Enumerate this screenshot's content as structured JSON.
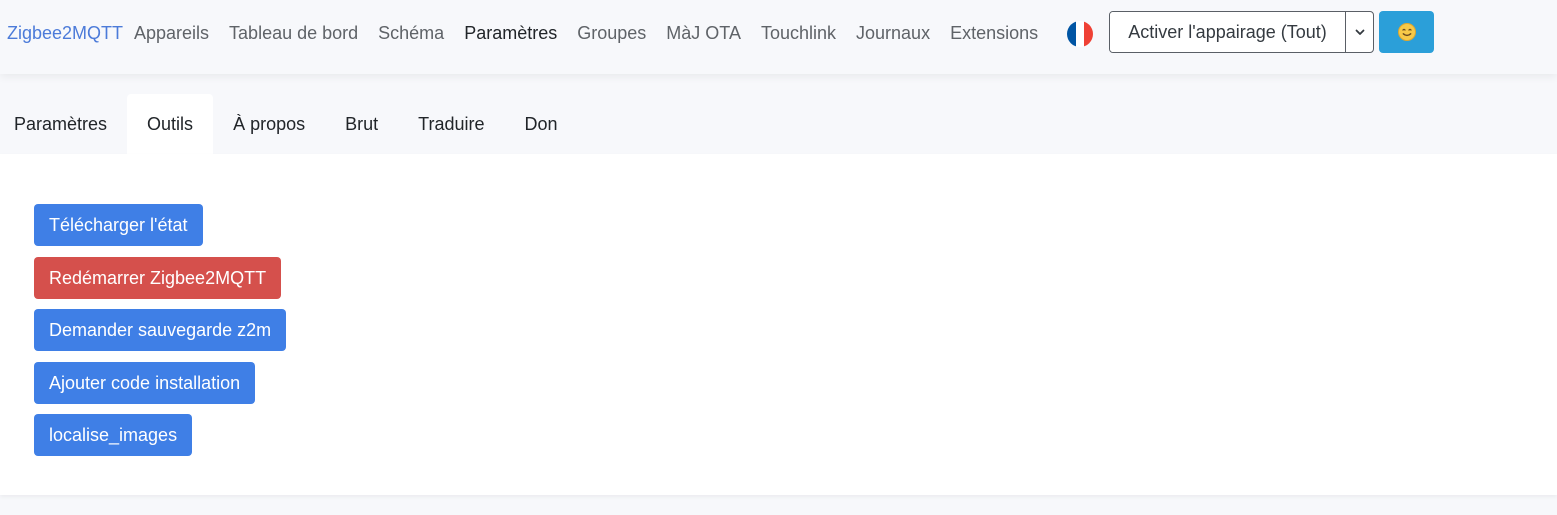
{
  "navbar": {
    "brand": "Zigbee2MQTT",
    "links": [
      {
        "label": "Appareils",
        "active": false
      },
      {
        "label": "Tableau de bord",
        "active": false
      },
      {
        "label": "Schéma",
        "active": false
      },
      {
        "label": "Paramètres",
        "active": true
      },
      {
        "label": "Groupes",
        "active": false
      },
      {
        "label": "MàJ OTA",
        "active": false
      },
      {
        "label": "Touchlink",
        "active": false
      },
      {
        "label": "Journaux",
        "active": false
      },
      {
        "label": "Extensions",
        "active": false
      }
    ],
    "language_flag": {
      "icon": "french-flag-icon",
      "colors": [
        "#0055a4",
        "#ffffff",
        "#ef4135"
      ]
    },
    "pairing_button": "Activer l'appairage (Tout)",
    "pairing_toggle_icon": "chevron-down-icon",
    "theme_button_icon": "smiley-icon",
    "theme_color": "#2b9fd9"
  },
  "tabs": [
    {
      "label": "Paramètres",
      "active": false
    },
    {
      "label": "Outils",
      "active": true
    },
    {
      "label": "À propos",
      "active": false
    },
    {
      "label": "Brut",
      "active": false
    },
    {
      "label": "Traduire",
      "active": false
    },
    {
      "label": "Don",
      "active": false
    }
  ],
  "tools": [
    {
      "label": "Télécharger l'état",
      "variant": "primary"
    },
    {
      "label": "Redémarrer Zigbee2MQTT",
      "variant": "danger"
    },
    {
      "label": "Demander sauvegarde z2m",
      "variant": "primary"
    },
    {
      "label": "Ajouter code installation",
      "variant": "primary"
    },
    {
      "label": "localise_images",
      "variant": "primary"
    }
  ],
  "colors": {
    "primary": "#3f7fe6",
    "danger": "#d5504c",
    "brand": "#4c7bd9"
  }
}
